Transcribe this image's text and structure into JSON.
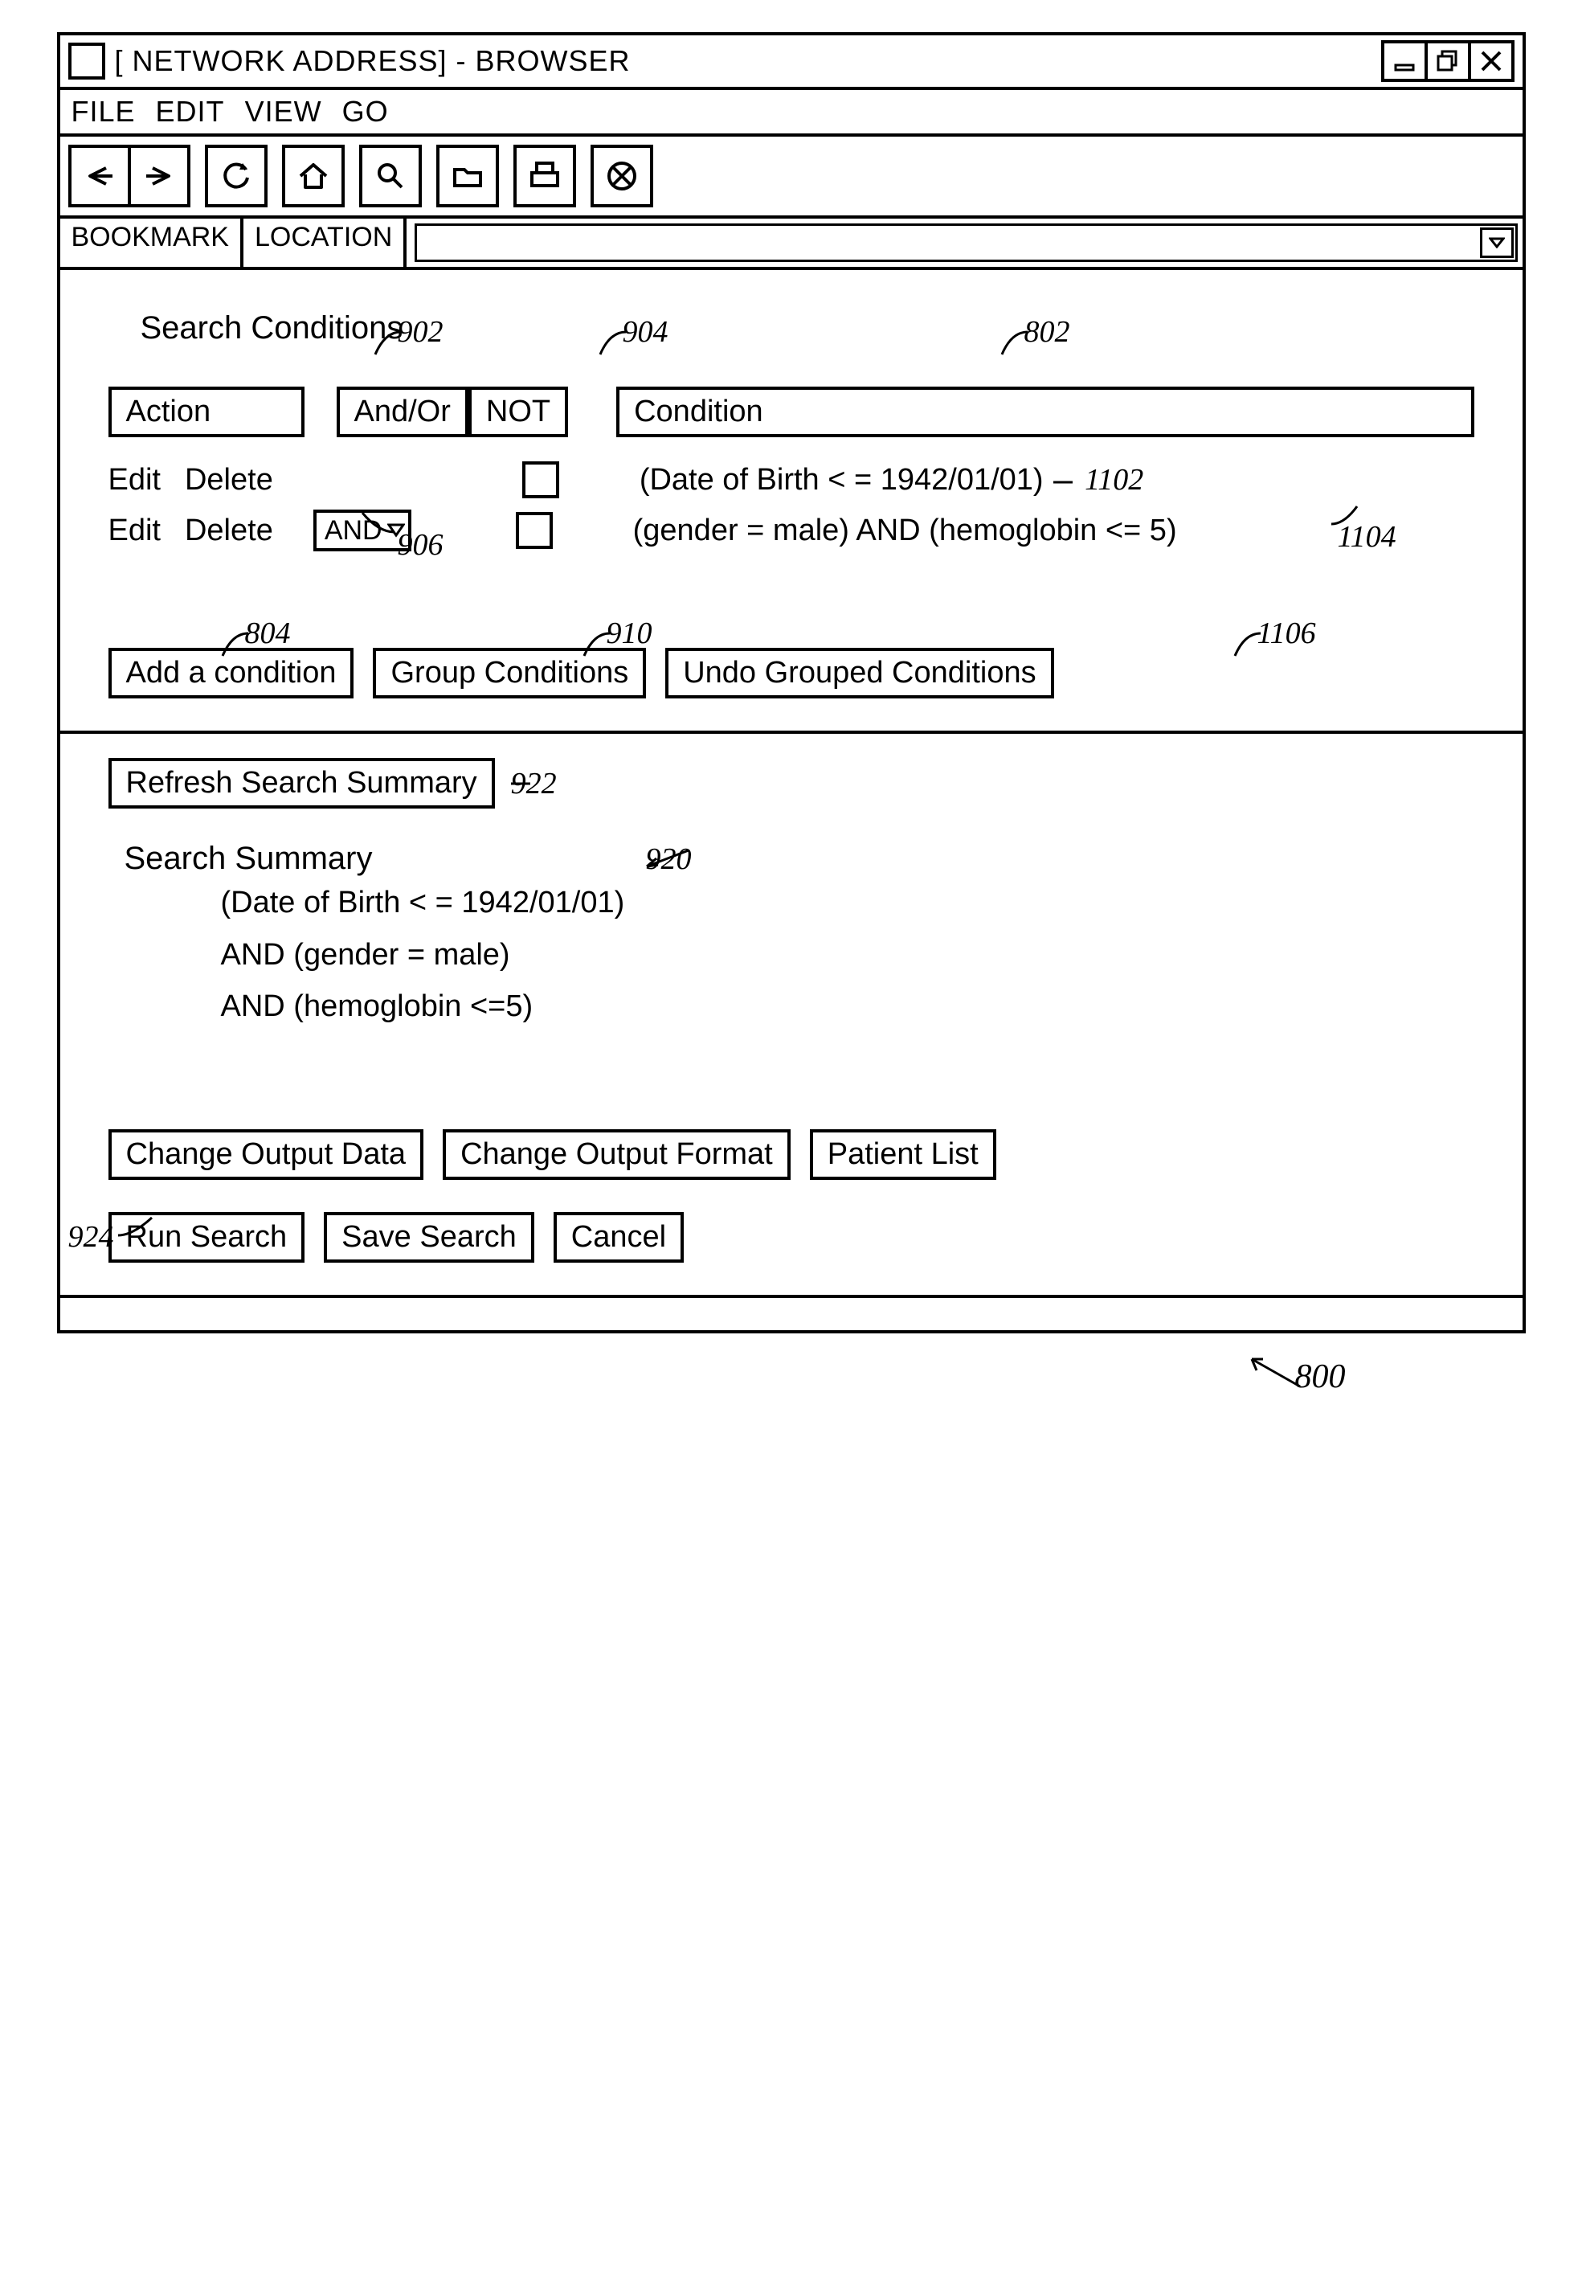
{
  "window": {
    "title": "[ NETWORK ADDRESS] - BROWSER"
  },
  "menubar": {
    "file": "FILE",
    "edit": "EDIT",
    "view": "VIEW",
    "go": "GO"
  },
  "locbar": {
    "bookmark": "BOOKMARK",
    "location": "LOCATION"
  },
  "page": {
    "search_conditions_heading": "Search Conditions",
    "headers": {
      "action": "Action",
      "andor": "And/Or",
      "not": "NOT",
      "condition": "Condition"
    },
    "rows": [
      {
        "edit": "Edit",
        "delete": "Delete",
        "andor": "",
        "not_checked": false,
        "condition": "(Date of Birth < = 1942/01/01)"
      },
      {
        "edit": "Edit",
        "delete": "Delete",
        "andor": "AND",
        "not_checked": false,
        "condition": "(gender = male) AND (hemoglobin <= 5)"
      }
    ],
    "buttons": {
      "add_condition": "Add a condition",
      "group_conditions": "Group Conditions",
      "undo_grouped": "Undo Grouped Conditions",
      "refresh_summary": "Refresh Search Summary"
    },
    "search_summary_heading": "Search Summary",
    "summary_lines": [
      "(Date of Birth < = 1942/01/01)",
      "AND (gender = male)",
      "AND (hemoglobin <=5)"
    ],
    "footer": {
      "change_output_data": "Change Output Data",
      "change_output_format": "Change Output Format",
      "patient_list": "Patient List",
      "run_search": "Run Search",
      "save_search": "Save Search",
      "cancel": "Cancel"
    }
  },
  "callouts": {
    "c902": "902",
    "c904": "904",
    "c802": "802",
    "c1102": "1102",
    "c906": "906",
    "c1104": "1104",
    "c804": "804",
    "c910": "910",
    "c1106": "1106",
    "c922": "922",
    "c920": "920",
    "c924": "924",
    "c800": "800"
  }
}
